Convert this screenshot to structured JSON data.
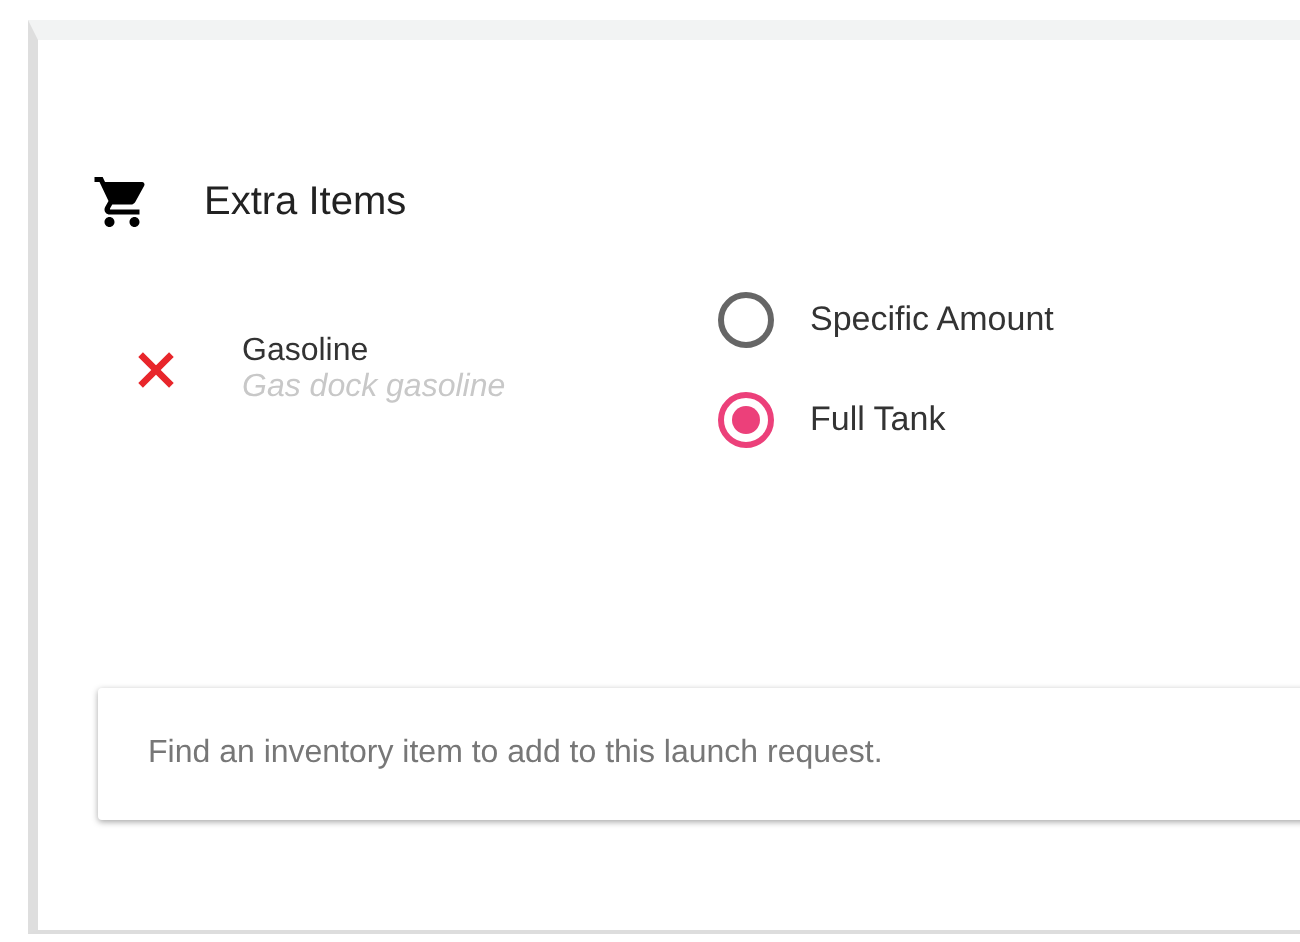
{
  "section": {
    "title": "Extra Items"
  },
  "items": [
    {
      "name": "Gasoline",
      "description": "Gas dock gasoline",
      "options": [
        {
          "label": "Specific Amount",
          "selected": false
        },
        {
          "label": "Full Tank",
          "selected": true
        }
      ]
    }
  ],
  "search": {
    "placeholder": "Find an inventory item to add to this launch request."
  }
}
